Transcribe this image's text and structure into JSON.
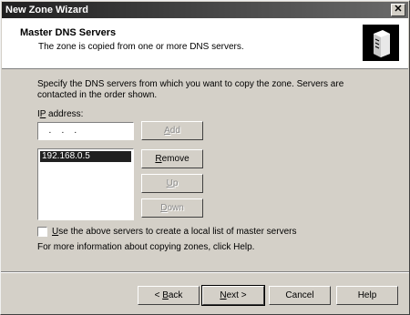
{
  "window": {
    "title": "New Zone Wizard",
    "close_glyph": "✕"
  },
  "header": {
    "title": "Master DNS Servers",
    "subtitle": "The zone is copied from one or more DNS servers.",
    "icon": "server-icon"
  },
  "content": {
    "description": "Specify the DNS servers from which you want to copy the zone. Servers are contacted in the order shown.",
    "ip_label_pre": "I",
    "ip_label_access": "P",
    "ip_label_post": " address:",
    "ip_value": "  .    .    .  ",
    "servers": [
      "192.168.0.5"
    ],
    "add_pre": "",
    "add_access": "A",
    "add_post": "dd",
    "remove_pre": "",
    "remove_access": "R",
    "remove_post": "emove",
    "up_pre": "",
    "up_access": "U",
    "up_post": "p",
    "down_pre": "",
    "down_access": "D",
    "down_post": "own",
    "checkbox_pre": "",
    "checkbox_access": "U",
    "checkbox_post": "se the above servers to create a local list of master servers",
    "help_text": "For more information about copying zones, click Help."
  },
  "footer": {
    "back_pre": "< ",
    "back_access": "B",
    "back_post": "ack",
    "next_pre": "",
    "next_access": "N",
    "next_post": "ext >",
    "cancel": "Cancel",
    "help": "Help"
  }
}
